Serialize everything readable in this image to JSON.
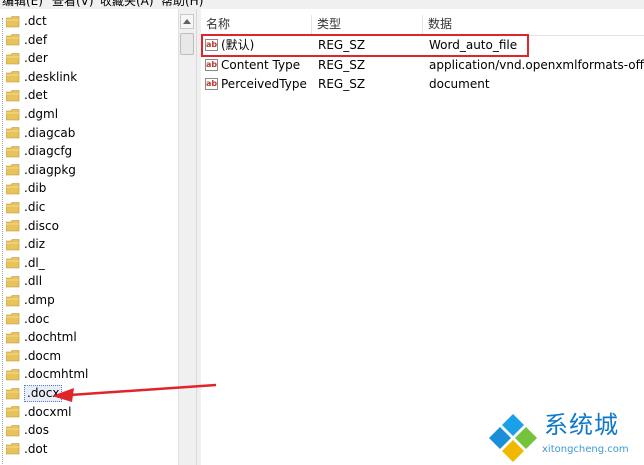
{
  "menu": {
    "items": [
      "编辑(E)",
      "查看(V)",
      "收藏夹(A)",
      "帮助(H)"
    ]
  },
  "tree": {
    "items": [
      ".dct",
      ".def",
      ".der",
      ".desklink",
      ".det",
      ".dgml",
      ".diagcab",
      ".diagcfg",
      ".diagpkg",
      ".dib",
      ".dic",
      ".disco",
      ".diz",
      ".dl_",
      ".dll",
      ".dmp",
      ".doc",
      ".dochtml",
      ".docm",
      ".docmhtml",
      ".docx",
      ".docxml",
      ".dos",
      ".dot"
    ],
    "selected": ".docx"
  },
  "list": {
    "columns": [
      "名称",
      "类型",
      "数据"
    ],
    "rows": [
      {
        "name": "(默认)",
        "type": "REG_SZ",
        "data": "Word_auto_file"
      },
      {
        "name": "Content Type",
        "type": "REG_SZ",
        "data": "application/vnd.openxmlformats-officed"
      },
      {
        "name": "PerceivedType",
        "type": "REG_SZ",
        "data": "document"
      }
    ],
    "icon_label": "ab"
  },
  "watermark": {
    "title": "系统城",
    "url": "xitongcheng.com"
  },
  "colors": {
    "highlight": "#e0242a",
    "folder": "#e8c25a",
    "brand": "#0d79c8"
  }
}
